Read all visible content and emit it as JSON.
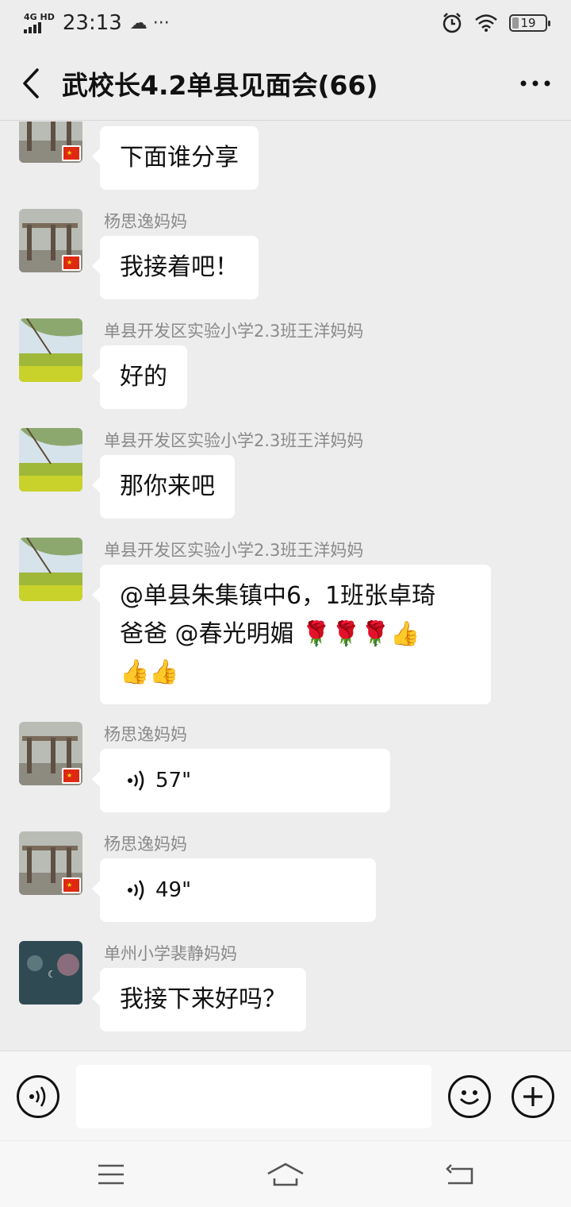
{
  "status_bar": {
    "network": "4G HD",
    "time": "23:13",
    "extra": "☁ ···",
    "battery": "19"
  },
  "nav": {
    "title": "武校长4.2单县见面会(66)"
  },
  "messages": [
    {
      "sender": "",
      "text": "下面谁分享",
      "avatar": "bridge"
    },
    {
      "sender": "杨思逸妈妈",
      "text": "我接着吧！",
      "avatar": "bridge"
    },
    {
      "sender": "单县开发区实验小学2.3班王洋妈妈",
      "text": "好的",
      "avatar": "field"
    },
    {
      "sender": "单县开发区实验小学2.3班王洋妈妈",
      "text": "那你来吧",
      "avatar": "field"
    },
    {
      "sender": "单县开发区实验小学2.3班王洋妈妈",
      "text_line1": "@单县朱集镇中6，1班张卓琦",
      "text_line2": "爸爸 @春光明媚",
      "emoji_line2": "🌹🌹🌹👍",
      "emoji_line3": "👍👍",
      "avatar": "field"
    },
    {
      "sender": "杨思逸妈妈",
      "voice": "57\"",
      "avatar": "bridge"
    },
    {
      "sender": "杨思逸妈妈",
      "voice": "49\"",
      "avatar": "bridge"
    },
    {
      "sender": "单州小学裴静妈妈",
      "text": "我接下来好吗？",
      "avatar": "night"
    }
  ],
  "input": {
    "placeholder": ""
  },
  "colors": {
    "background": "#ededed",
    "bubble": "#ffffff",
    "sender": "#8a8a8a"
  }
}
